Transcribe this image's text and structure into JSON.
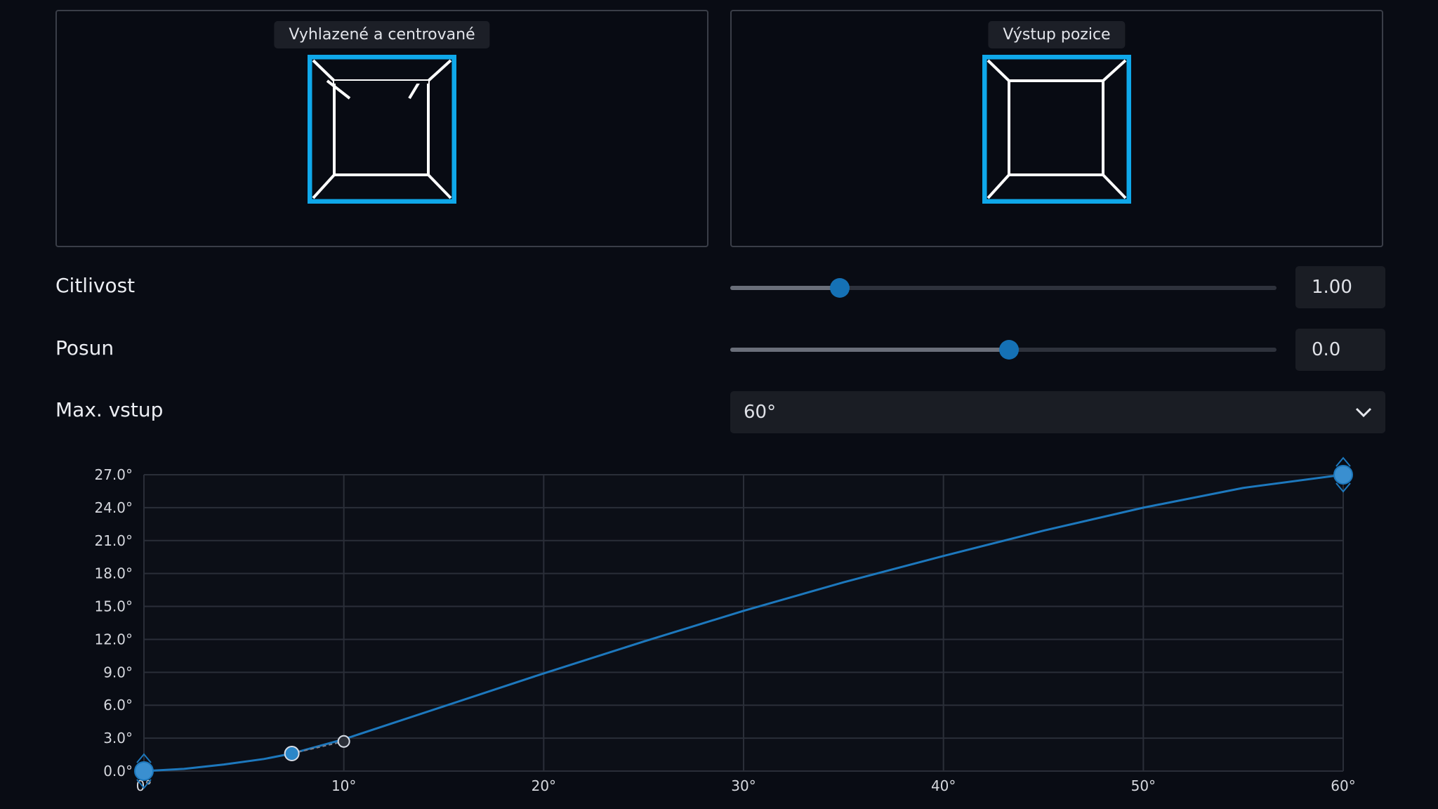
{
  "previews": {
    "left_title": "Vyhlazené a centrované",
    "right_title": "Výstup pozice"
  },
  "controls": {
    "sensitivity": {
      "label": "Citlivost",
      "value": "1.00",
      "fraction": 0.2
    },
    "offset": {
      "label": "Posun",
      "value": "0.0",
      "fraction": 0.51
    },
    "max_input": {
      "label": "Max. vstup",
      "selected": "60°"
    }
  },
  "colors": {
    "accent": "#1571b5",
    "preview_frame": "#0fa8ea",
    "curve": "#1d78bd"
  },
  "icons": {
    "dropdown": "chevron-down-icon"
  },
  "chart_data": {
    "type": "line",
    "title": "",
    "xlabel": "",
    "ylabel": "",
    "xlim": [
      0,
      60
    ],
    "ylim": [
      0,
      27
    ],
    "x_ticks": [
      "0°",
      "10°",
      "20°",
      "30°",
      "40°",
      "50°",
      "60°"
    ],
    "y_ticks": [
      "0.0°",
      "3.0°",
      "6.0°",
      "9.0°",
      "12.0°",
      "15.0°",
      "18.0°",
      "21.0°",
      "24.0°",
      "27.0°"
    ],
    "grid": true,
    "series": [
      {
        "name": "",
        "x": [
          0,
          2,
          4,
          6,
          7.4,
          10,
          15,
          20,
          25,
          30,
          35,
          40,
          45,
          50,
          55,
          60
        ],
        "y": [
          0,
          0.2,
          0.6,
          1.1,
          1.6,
          2.9,
          5.9,
          8.9,
          11.8,
          14.6,
          17.2,
          19.6,
          21.9,
          24.0,
          25.8,
          27.0
        ]
      }
    ],
    "control_points": [
      {
        "x": 0,
        "y": 0,
        "kind": "endpoint"
      },
      {
        "x": 7.4,
        "y": 1.6,
        "kind": "point"
      },
      {
        "x": 10.0,
        "y": 2.7,
        "kind": "handle"
      },
      {
        "x": 60,
        "y": 27,
        "kind": "endpoint"
      }
    ]
  }
}
